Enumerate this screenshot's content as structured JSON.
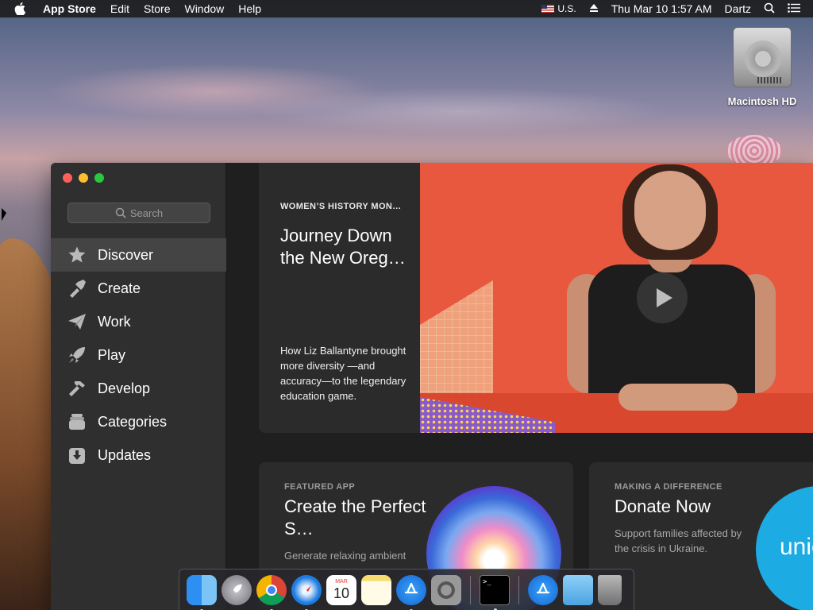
{
  "menubar": {
    "app_name": "App Store",
    "items": [
      "Edit",
      "Store",
      "Window",
      "Help"
    ],
    "input_source": "U.S.",
    "clock": "Thu Mar 10  1:57 AM",
    "user": "Dartz"
  },
  "desktop": {
    "hd_label": "Macintosh HD"
  },
  "sidebar": {
    "search_placeholder": "Search",
    "items": [
      {
        "label": "Discover",
        "icon": "star-icon",
        "active": true
      },
      {
        "label": "Create",
        "icon": "brush-icon"
      },
      {
        "label": "Work",
        "icon": "paper-plane-icon"
      },
      {
        "label": "Play",
        "icon": "rocket-icon"
      },
      {
        "label": "Develop",
        "icon": "hammer-icon"
      },
      {
        "label": "Categories",
        "icon": "categories-icon"
      },
      {
        "label": "Updates",
        "icon": "download-icon"
      }
    ]
  },
  "hero": {
    "eyebrow": "WOMEN’S HISTORY MON…",
    "title": "Journey Down the New Oreg…",
    "description": "How Liz Ballantyne brought more diversity —and accuracy—to the legendary education game."
  },
  "cards": [
    {
      "eyebrow": "FEATURED APP",
      "title": "Create the Perfect S…",
      "description": "Generate relaxing ambient"
    },
    {
      "eyebrow": "MAKING A DIFFERENCE",
      "title": "Donate Now",
      "description": "Support families affected by the crisis in Ukraine.",
      "logo_text": "unic"
    }
  ],
  "dock": {
    "items": [
      "finder-icon",
      "launchpad-icon",
      "chrome-icon",
      "safari-icon",
      "calendar-icon",
      "notes-icon",
      "app-store-icon",
      "system-preferences-icon",
      "terminal-icon",
      "app-store-folder-icon",
      "downloads-folder-icon",
      "trash-icon"
    ],
    "calendar_month": "MAR",
    "calendar_day": "10",
    "terminal_prompt": ">_"
  },
  "colors": {
    "close": "#ff5f57",
    "minimize": "#febc2e",
    "maximize": "#28c840",
    "sidebar_bg": "#2f2f2f",
    "hero_bg": "#e8583f",
    "unicef_blue": "#1cabe2"
  }
}
